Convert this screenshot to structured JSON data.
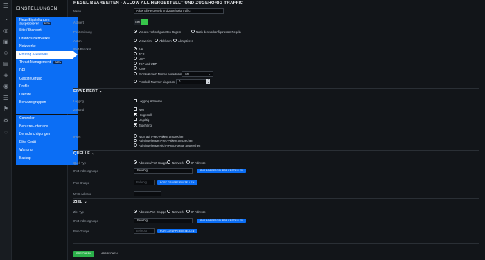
{
  "sidebar": {
    "title": "EINSTELLUNGEN",
    "group1": [
      {
        "label": "Neue Einstellungen",
        "label2": "ausprobieren",
        "badge": "BETA"
      },
      {
        "label": "Site / Standort"
      },
      {
        "label": "Drahtlos-Netzwerke"
      },
      {
        "label": "Netzwerke"
      },
      {
        "label": "Routing & Firewall"
      },
      {
        "label": "Threat Management",
        "badge": "BETA"
      },
      {
        "label": "DPI"
      },
      {
        "label": "Gaststeuerung"
      },
      {
        "label": "Profile"
      },
      {
        "label": "Dienste"
      },
      {
        "label": "Benutzergruppen"
      }
    ],
    "group2": [
      {
        "label": "Controller"
      },
      {
        "label": "Benutzer-Interface"
      },
      {
        "label": "Benachrichtigungen"
      },
      {
        "label": "Elite-Gerät"
      },
      {
        "label": "Wartung"
      },
      {
        "label": "Backup"
      }
    ]
  },
  "main": {
    "title": "REGEL BEARBEITEN - ALLOW ALL HERGESTELLT UND ZUGEHORIG TRAFFIC",
    "name_label": "Name",
    "name_value": "Allow All Hergestellt und Zugehörig Traffic",
    "enabled_label": "Aktiviert",
    "enabled_value": "EIN",
    "position_label": "Positionierung",
    "position_opt1": "Vor den vorkonfigurierten Regeln",
    "position_opt2": "Nach den vorkonfigurierten Regeln",
    "action_label": "Aktion",
    "action_opt1": "Verwerfen",
    "action_opt2": "Ablehnen",
    "action_opt3": "Akzeptieren",
    "protocol_label": "IPv4-Protokoll",
    "protocol_opts": [
      "Alle",
      "TCP",
      "UDP",
      "TCP und UDP",
      "ICMP"
    ],
    "protocol_by_name": "Protokoll nach Namen auswählen",
    "protocol_by_name_value": "AH",
    "protocol_number": "Protokoll-Nummer eingeben",
    "protocol_number_value": "0",
    "advanced_title": "ERWEITERT",
    "logging_label": "Logging",
    "logging_opt": "Logging aktivieren",
    "state_label": "Zustand",
    "state_opts": [
      "Neu",
      "Hergestellt",
      "Ungültig",
      "Zugehörig"
    ],
    "ipsec_label": "IPsec",
    "ipsec_opts": [
      "Nicht auf IPsec-Pakete ansprechen",
      "Auf eingehende IPsec-Pakete ansprechen",
      "Auf eingehende Nicht-IPsec-Pakete ansprechen"
    ],
    "source_title": "QUELLE",
    "source_type_label": "Quell-Typ",
    "type_opt1": "Adressen/Port-Gruppe",
    "type_opt2": "Netzwerk",
    "type_opt3": "IP-Adresse",
    "addr_group_label": "IPv4-Adressgruppe",
    "addr_group_value": "Beliebig",
    "addr_group_button": "IPV4-ADRESSGRUPPE ERSTELLEN",
    "port_group_label": "Port-Gruppe",
    "port_group_value": "Beliebig",
    "port_group_button": "PORT-GRUPPE ERSTELLEN",
    "mac_label": "MAC-Adresse",
    "dest_title": "ZIEL",
    "dest_type_label": "Ziel-Typ",
    "dest_type_opt1": "Adresse/Port-Gruppe",
    "save_button": "SPEICHERN",
    "cancel_button": "ABBRECHEN"
  },
  "colors": {
    "accent": "#0b6ef5",
    "toggle_on": "#37c64a",
    "save": "#2bb14a",
    "background": "#121519"
  }
}
